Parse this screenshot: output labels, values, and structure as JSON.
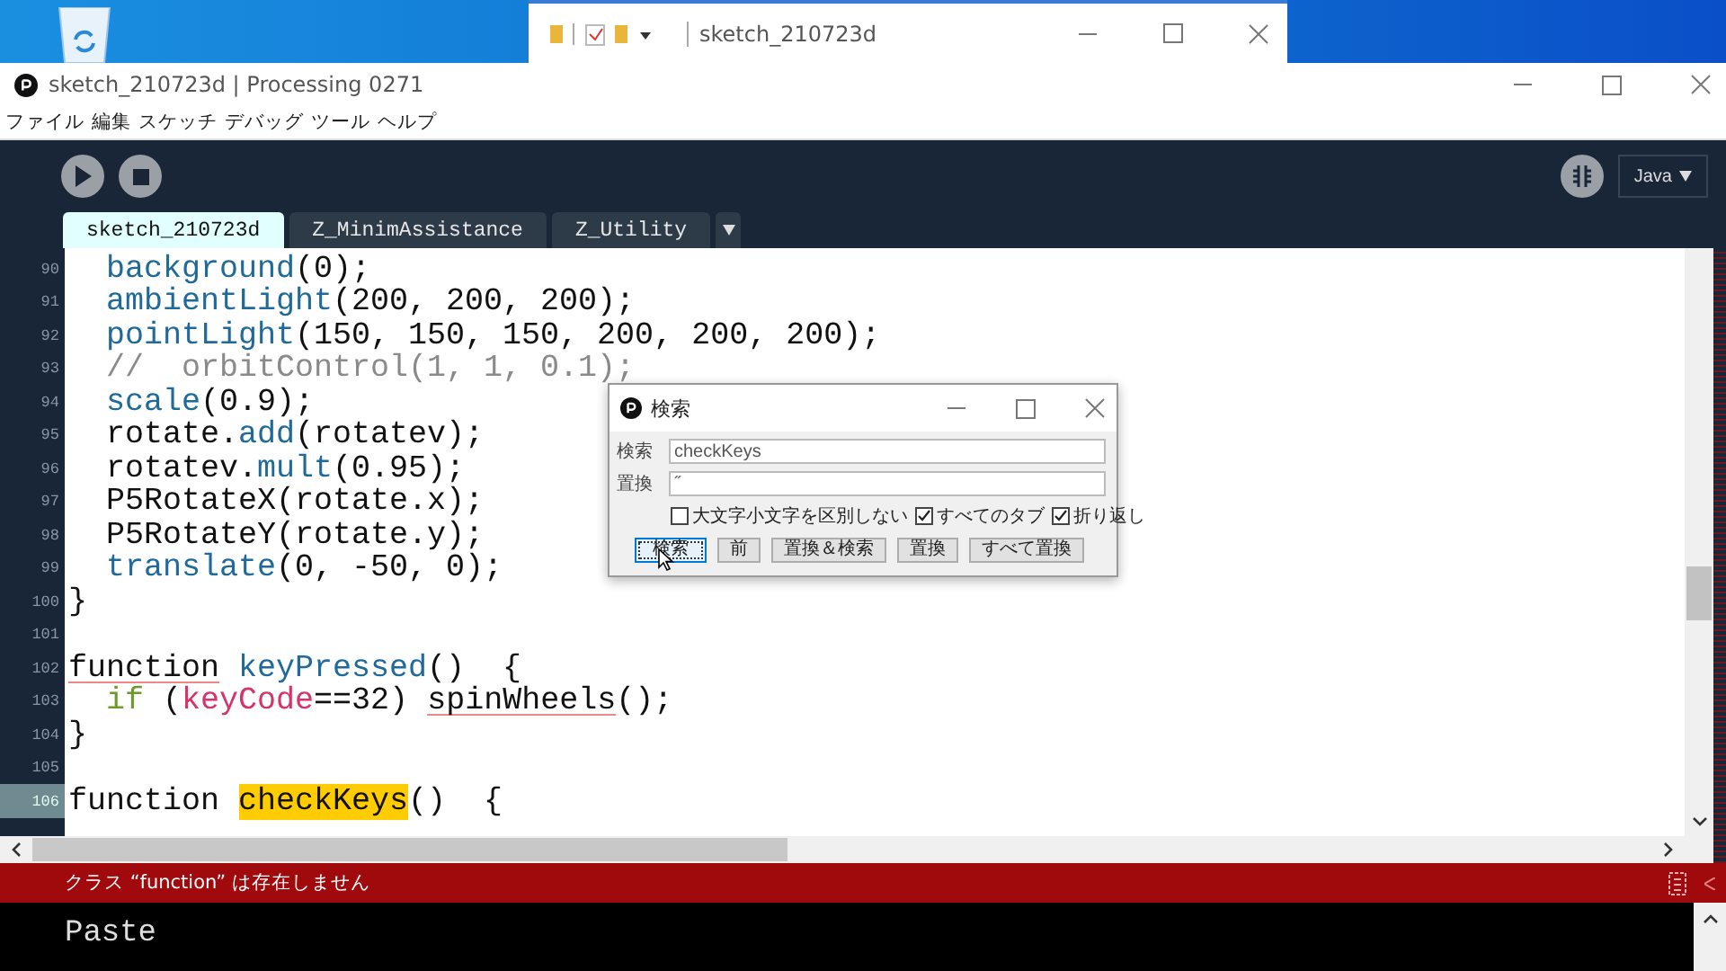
{
  "background_window": {
    "title": "sketch_210723d"
  },
  "window": {
    "title": "sketch_210723d | Processing 0271"
  },
  "menu": [
    "ファイル",
    "編集",
    "スケッチ",
    "デバッグ",
    "ツール",
    "ヘルプ"
  ],
  "toolbar": {
    "mode": "Java"
  },
  "tabs": [
    {
      "label": "sketch_210723d",
      "selected": true
    },
    {
      "label": "Z_MinimAssistance",
      "selected": false
    },
    {
      "label": "Z_Utility",
      "selected": false
    }
  ],
  "editor": {
    "lines": [
      {
        "number": "90",
        "current": false,
        "segments": [
          {
            "text": "  background",
            "kind": "function"
          },
          {
            "text": "(0);",
            "kind": "plain"
          }
        ]
      },
      {
        "number": "91",
        "current": false,
        "segments": [
          {
            "text": "  ambientLight",
            "kind": "function"
          },
          {
            "text": "(200, 200, 200);",
            "kind": "plain"
          }
        ]
      },
      {
        "number": "92",
        "current": false,
        "segments": [
          {
            "text": "  pointLight",
            "kind": "function"
          },
          {
            "text": "(150, 150, 150, 200, 200, 200);",
            "kind": "plain"
          }
        ]
      },
      {
        "number": "93",
        "current": false,
        "segments": [
          {
            "text": "  //  orbitControl(1, 1, 0.1);",
            "kind": "comment"
          }
        ]
      },
      {
        "number": "94",
        "current": false,
        "segments": [
          {
            "text": "  scale",
            "kind": "function"
          },
          {
            "text": "(0.9);",
            "kind": "plain"
          }
        ]
      },
      {
        "number": "95",
        "current": false,
        "segments": [
          {
            "text": "  rotate.",
            "kind": "plain"
          },
          {
            "text": "add",
            "kind": "function"
          },
          {
            "text": "(rotatev);",
            "kind": "plain"
          }
        ]
      },
      {
        "number": "96",
        "current": false,
        "segments": [
          {
            "text": "  rotatev.",
            "kind": "plain"
          },
          {
            "text": "mult",
            "kind": "function"
          },
          {
            "text": "(0.95);",
            "kind": "plain"
          }
        ]
      },
      {
        "number": "97",
        "current": false,
        "segments": [
          {
            "text": "  P5RotateX(rotate.x);",
            "kind": "plain"
          }
        ]
      },
      {
        "number": "98",
        "current": false,
        "segments": [
          {
            "text": "  P5RotateY(rotate.y);",
            "kind": "plain"
          }
        ]
      },
      {
        "number": "99",
        "current": false,
        "segments": [
          {
            "text": "  translate",
            "kind": "function"
          },
          {
            "text": "(0, -50, 0);",
            "kind": "plain"
          }
        ]
      },
      {
        "number": "100",
        "current": false,
        "segments": [
          {
            "text": "}",
            "kind": "plain"
          }
        ]
      },
      {
        "number": "101",
        "current": false
      },
      {
        "number": "102",
        "current": false,
        "segments": [
          {
            "text": "function",
            "kind": "error"
          },
          {
            "text": " keyPressed",
            "kind": "function"
          },
          {
            "text": "()  {",
            "kind": "plain"
          }
        ]
      },
      {
        "number": "103",
        "current": false,
        "segments": [
          {
            "text": "  if",
            "kind": "keyword"
          },
          {
            "text": " (",
            "kind": "plain"
          },
          {
            "text": "keyCode",
            "kind": "variable"
          },
          {
            "text": "==32) ",
            "kind": "plain"
          },
          {
            "text": "spinWheels",
            "kind": "error"
          },
          {
            "text": "();",
            "kind": "plain"
          }
        ]
      },
      {
        "number": "104",
        "current": false,
        "segments": [
          {
            "text": "}",
            "kind": "plain"
          }
        ]
      },
      {
        "number": "105",
        "current": false
      },
      {
        "number": "106",
        "current": true,
        "segments": [
          {
            "text": "function ",
            "kind": "plain"
          },
          {
            "text": "checkKeys",
            "kind": "match"
          },
          {
            "text": "()  {",
            "kind": "plain"
          }
        ]
      }
    ]
  },
  "status_bar": {
    "message": "クラス “function” は存在しません"
  },
  "console": {
    "lines": [
      "Paste"
    ]
  },
  "find_dialog": {
    "title": "検索",
    "fields": [
      {
        "label": "検索",
        "value": "checkKeys"
      },
      {
        "label": "置換",
        "value": "˝"
      }
    ],
    "options": [
      {
        "label": "大文字小文字を区別しない",
        "checked": false
      },
      {
        "label": "すべてのタブ",
        "checked": true
      },
      {
        "label": "折り返し",
        "checked": true
      }
    ],
    "buttons": [
      {
        "label": "検索",
        "selected": true
      },
      {
        "label": "前",
        "selected": false
      },
      {
        "label": "置換＆検索",
        "selected": false
      },
      {
        "label": "置換",
        "selected": false
      },
      {
        "label": "すべて置換",
        "selected": false
      }
    ]
  }
}
